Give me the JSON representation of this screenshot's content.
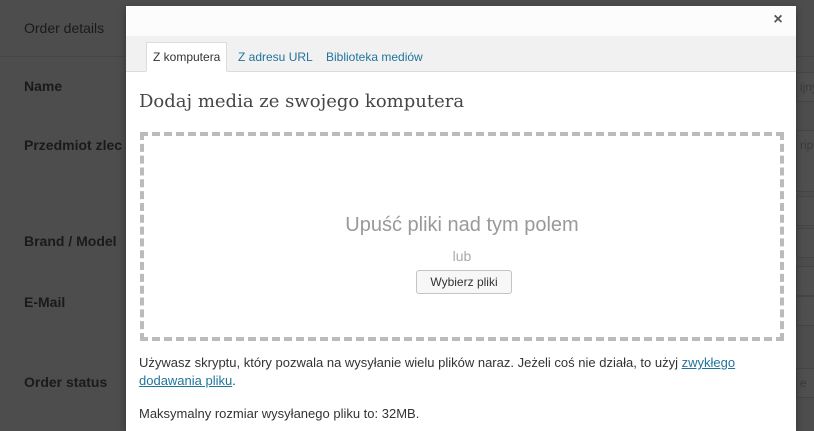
{
  "background": {
    "title": "Order details",
    "fields": [
      {
        "label": "Name"
      },
      {
        "label": "Przedmiot zlec"
      },
      {
        "label": "Brand / Model"
      },
      {
        "label": "E-Mail"
      },
      {
        "label": "Order status"
      }
    ],
    "right_texts": [
      "ijny",
      "rip",
      "e"
    ]
  },
  "modal": {
    "close_label": "×",
    "tabs": [
      {
        "label": "Z komputera"
      },
      {
        "label": "Z adresu URL"
      },
      {
        "label": "Biblioteka mediów"
      }
    ],
    "heading": "Dodaj media ze swojego komputera",
    "dropzone": {
      "text": "Upuść pliki nad tym polem",
      "or": "lub",
      "button": "Wybierz pliki"
    },
    "info_text": "Używasz skryptu, który pozwala na wysyłanie wielu plików naraz. Jeżeli coś nie działa, to użyj ",
    "info_link": "zwykłego dodawania pliku",
    "info_end": ".",
    "max_size": "Maksymalny rozmiar wysyłanego pliku to: 32MB."
  }
}
